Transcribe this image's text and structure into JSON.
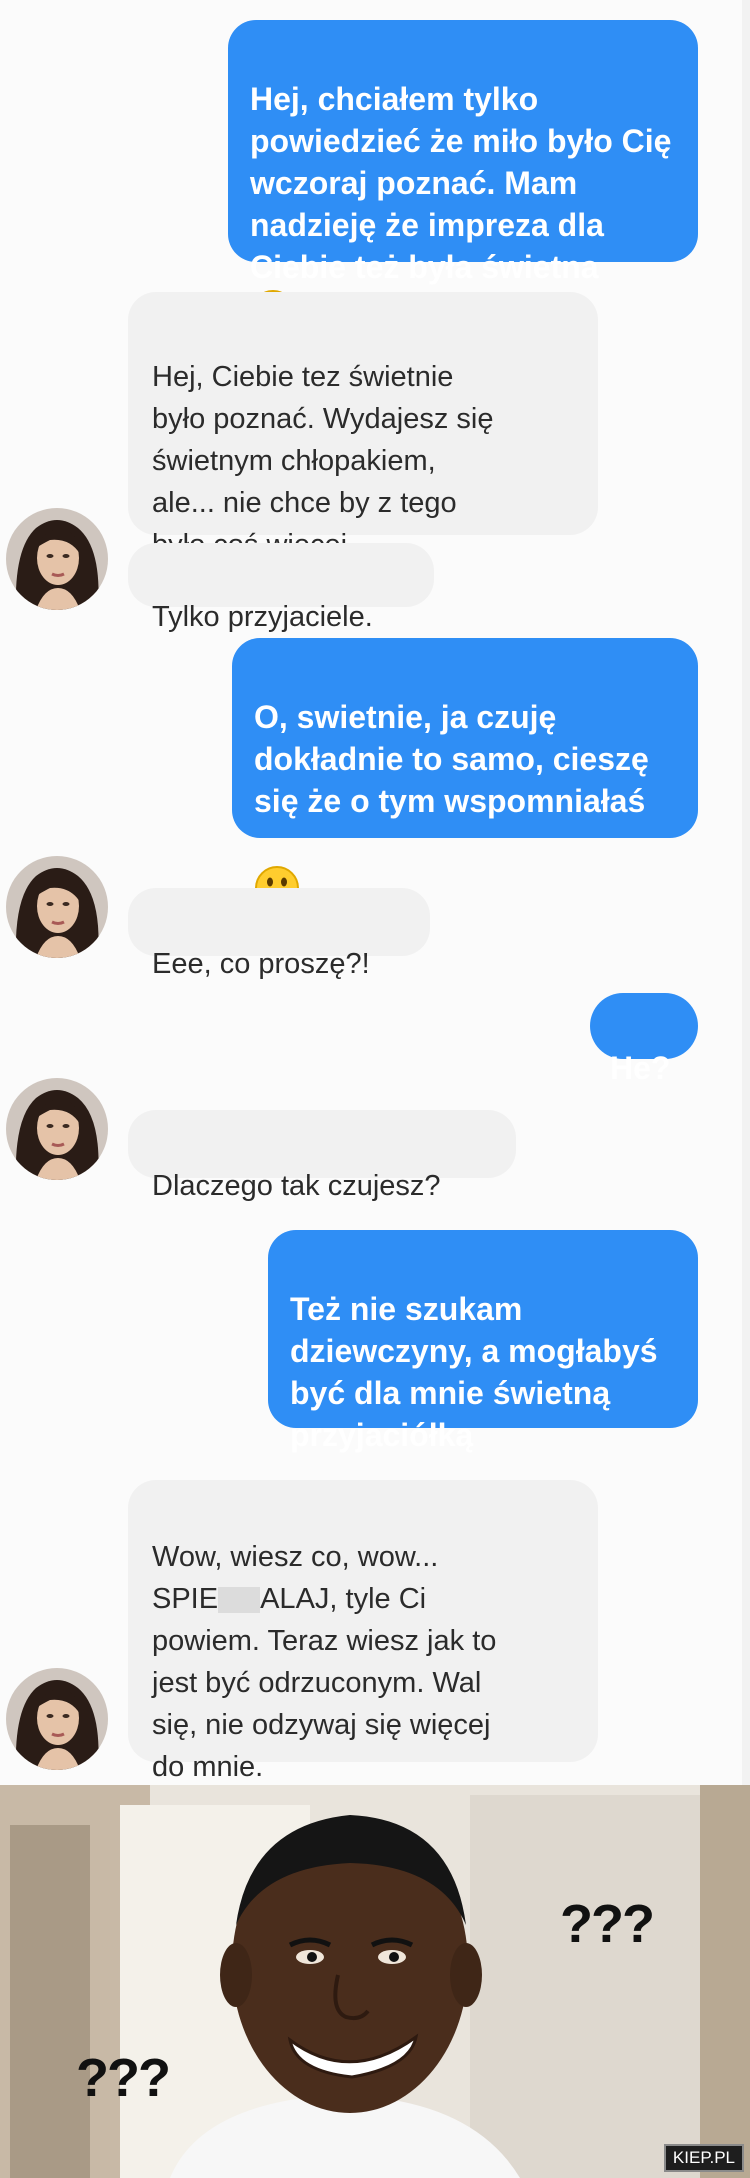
{
  "colors": {
    "sent_bubble": "#2f8ef5",
    "received_bubble": "#f1f1f1",
    "received_text": "#2b2b2b",
    "chat_background": "#fbfbfb"
  },
  "messages": [
    {
      "from": "me",
      "text": "Hej, chciałem tylko\npowiedzieć że miło było Cię\nwczoraj poznać. Mam\nnadzieję że impreza dla\nCiebie też była świetna",
      "emoji": "winking-face"
    },
    {
      "from": "her",
      "text": "Hej, Ciebie tez świetnie\nbyło poznać. Wydajesz się\nświetnym chłopakiem,\nale... nie chce by z tego\nbyło coś więcej."
    },
    {
      "from": "her",
      "text": "Tylko przyjaciele."
    },
    {
      "from": "me",
      "text": "O, swietnie, ja czuję\ndokładnie to samo, cieszę\nsię że o tym wspomniałaś",
      "emoji": "grinning-face"
    },
    {
      "from": "her",
      "text": "Eee, co proszę?!"
    },
    {
      "from": "me",
      "text": "He?"
    },
    {
      "from": "her",
      "text": "Dlaczego tak czujesz?"
    },
    {
      "from": "me",
      "text": "Też nie szukam\ndziewczyny, a mogłabyś\nbyć dla mnie świetną\nprzyjaciółką"
    },
    {
      "from": "her",
      "text_before": "Wow, wiesz co, wow...\nSPIE",
      "text_after": "ALAJ, tyle Ci\npowiem. Teraz wiesz jak to\njest być odrzuconym. Wal\nsię, nie odzywaj się więcej\ndo mnie."
    }
  ],
  "meme": {
    "left_caption": "???",
    "right_caption": "???",
    "watermark": "KIEP.PL"
  }
}
